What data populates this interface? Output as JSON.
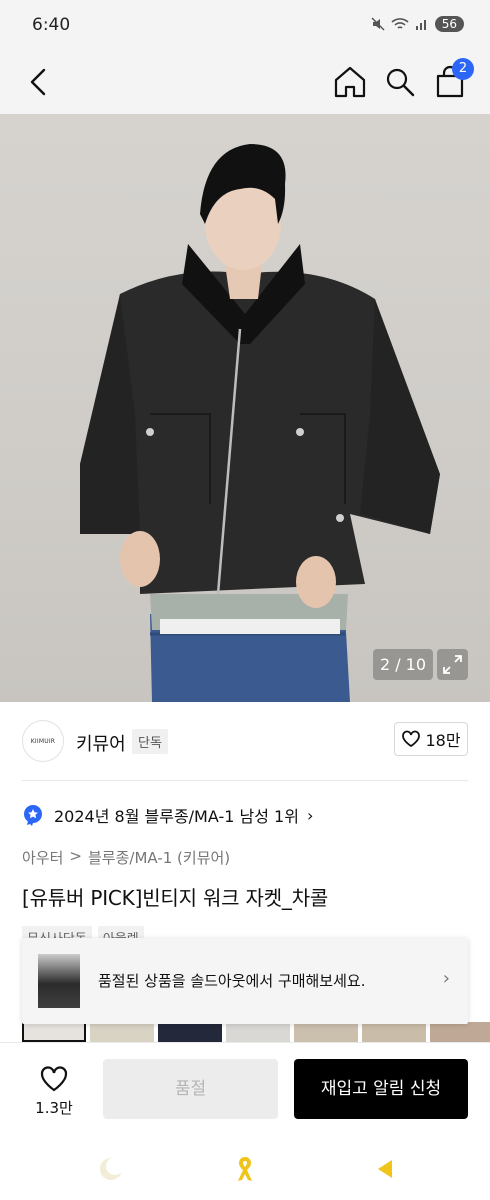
{
  "status_bar": {
    "time": "6:40",
    "network": "5G",
    "battery": "56"
  },
  "nav": {
    "cart_count": "2"
  },
  "gallery": {
    "counter": "2 / 10"
  },
  "brand": {
    "logo_text": "KIIMUIR",
    "name": "키뮤어",
    "tag": "단독",
    "likes": "18만"
  },
  "ranking": {
    "text": "2024년 8월 블루종/MA-1 남성 1위"
  },
  "breadcrumb": {
    "category": "아우터",
    "separator": ">",
    "subcategory": "블루종/MA-1 (키뮤어)"
  },
  "product": {
    "title": "[유튜버 PICK]빈티지 워크 자켓_차콜"
  },
  "tags": [
    "무신사단독",
    "아울렛"
  ],
  "toast": {
    "message": "품절된 상품을 솔드아웃에서 구매해보세요."
  },
  "actions": {
    "wish_count": "1.3만",
    "soldout_label": "품절",
    "restock_label": "재입고 알림 신청"
  },
  "colors": {
    "accent": "#2b66f6",
    "primary_button": "#000000",
    "disabled_button": "#ececec"
  }
}
